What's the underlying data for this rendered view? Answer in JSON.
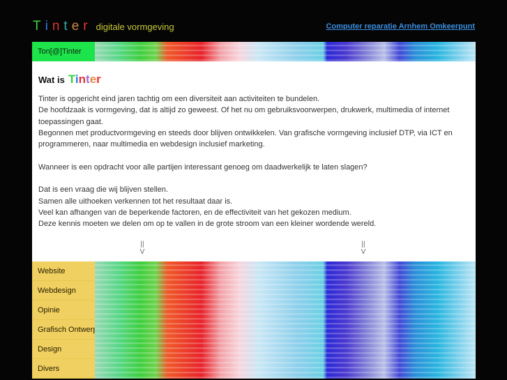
{
  "logo": {
    "letters": [
      "T",
      "i",
      "n",
      "t",
      "e",
      "r"
    ],
    "colors": [
      "#36d33c",
      "#2f7ee8",
      "#d33",
      "#3aa",
      "#c84",
      "#e33"
    ],
    "tagline": "digitale vormgeving"
  },
  "top_link": "Computer reparatie Arnhem Omkeerpunt",
  "header": {
    "label": "Ton[@]Tinter"
  },
  "content": {
    "heading_prefix": "Wat is",
    "heading_brand": "Tinter",
    "brand_colors": [
      "#36d33c",
      "#2f7ee8",
      "#d33",
      "#9a6cd8",
      "#e8884a",
      "#e33"
    ],
    "paragraphs": [
      "Tinter is opgericht eind jaren tachtig om een diversiteit aan activiteiten te bundelen.",
      "De hoofdzaak is vormgeving, dat is altijd zo geweest. Of het nu om gebruiksvoorwerpen, drukwerk, multimedia of internet toepassingen gaat.",
      "Begonnen met productvormgeving en steeds door blijven ontwikkelen. Van grafische vormgeving inclusief DTP, via ICT en programmeren, naar multimedia en webdesign inclusief marketing.",
      "",
      "Wanneer is een opdracht voor alle partijen interessant genoeg om daadwerkelijk te laten slagen?",
      "",
      "Dat is een vraag die wij blijven stellen.",
      "Samen alle uithoeken verkennen tot het resultaat daar is.",
      "Veel kan afhangen van de beperkende factoren, en de effectiviteit van het gekozen medium.",
      "Deze kennis moeten we delen om op te vallen in de grote stroom van een kleiner wordende wereld."
    ],
    "arrow_glyph": "||",
    "arrow_head": "V"
  },
  "nav": {
    "items": [
      {
        "label": "Website"
      },
      {
        "label": "Webdesign"
      },
      {
        "label": "Opinie"
      },
      {
        "label": "Grafisch Ontwerp"
      },
      {
        "label": "Design"
      },
      {
        "label": "Divers"
      }
    ]
  }
}
